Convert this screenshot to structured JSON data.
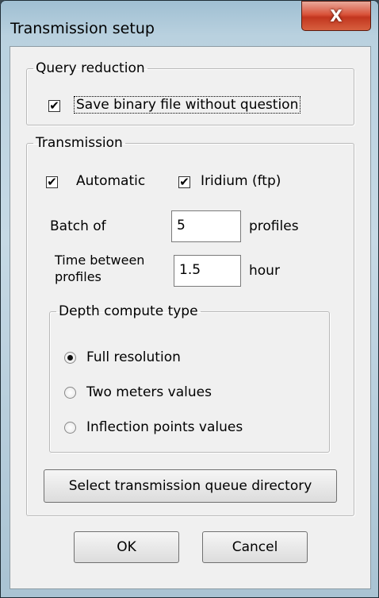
{
  "window": {
    "title": "Transmission setup",
    "close_label": "X"
  },
  "query_reduction": {
    "legend": "Query reduction",
    "save_binary": {
      "label": "Save binary file without question",
      "checked": true,
      "check_mark": "✔"
    }
  },
  "transmission": {
    "legend": "Transmission",
    "automatic": {
      "label": "Automatic",
      "checked": true,
      "check_mark": "✔"
    },
    "iridium": {
      "label": "Iridium (ftp)",
      "checked": true,
      "check_mark": "✔"
    },
    "batch": {
      "label": "Batch of",
      "value": "5",
      "unit": "profiles"
    },
    "time_between": {
      "label_line1": "Time between",
      "label_line2": "profiles",
      "value": "1.5",
      "unit": "hour"
    },
    "depth": {
      "legend": "Depth compute type",
      "options": [
        {
          "label": "Full resolution",
          "selected": true
        },
        {
          "label": "Two meters values",
          "selected": false
        },
        {
          "label": "Inflection points values",
          "selected": false
        }
      ]
    },
    "select_dir_button": "Select transmission queue directory"
  },
  "footer": {
    "ok": "OK",
    "cancel": "Cancel"
  }
}
